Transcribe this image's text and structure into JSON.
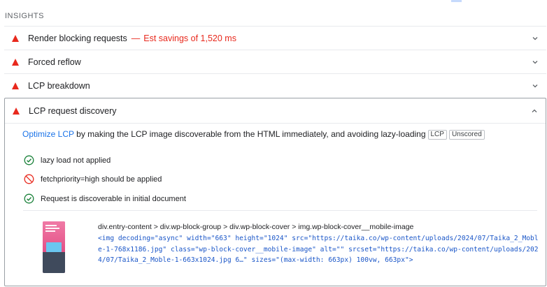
{
  "section": {
    "title": "INSIGHTS"
  },
  "insights": [
    {
      "label": "Render blocking requests",
      "separator": "—",
      "savings": "Est savings of 1,520 ms",
      "icon": "warning-triangle-icon"
    },
    {
      "label": "Forced reflow",
      "icon": "warning-triangle-icon"
    },
    {
      "label": "LCP breakdown",
      "icon": "warning-triangle-icon"
    }
  ],
  "expanded": {
    "label": "LCP request discovery",
    "description": {
      "link": "Optimize LCP",
      "text": " by making the LCP image discoverable from the HTML immediately, and avoiding lazy-loading",
      "tags": [
        "LCP",
        "Unscored"
      ]
    },
    "checks": [
      {
        "text": "lazy load not applied",
        "status": "pass",
        "icon": "check-circle-icon"
      },
      {
        "text": "fetchpriority=high should be applied",
        "status": "fail",
        "icon": "prohibited-icon"
      },
      {
        "text": "Request is discoverable in initial document",
        "status": "pass",
        "icon": "check-circle-icon"
      }
    ],
    "node": {
      "path": "div.entry-content > div.wp-block-group > div.wp-block-cover > img.wp-block-cover__mobile-image",
      "snippet": "<img decoding=\"async\" width=\"663\" height=\"1024\" src=\"https://taika.co/wp-content/uploads/2024/07/Taika_2_Moble-1-768x1186.jpg\" class=\"wp-block-cover__mobile-image\" alt=\"\" srcset=\"https://taika.co/wp-content/uploads/2024/07/Taika_2_Moble-1-663x1024.jpg 6…\" sizes=\"(max-width: 663px) 100vw, 663px\">"
    }
  },
  "colors": {
    "warning": "#e8291d",
    "pass": "#188038",
    "fail": "#e8291d",
    "link": "#1a73e8",
    "code": "#1a56c8"
  }
}
